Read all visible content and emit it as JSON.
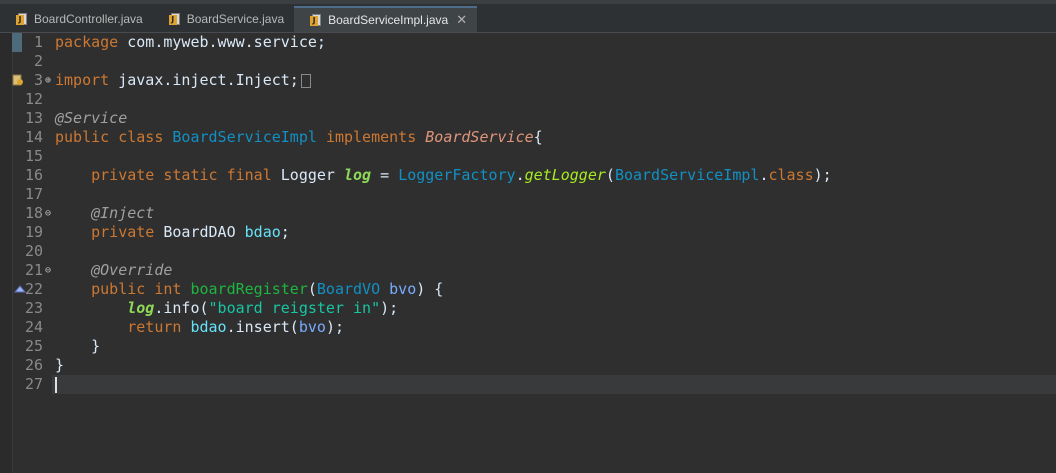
{
  "tabs": [
    {
      "label": "BoardController.java",
      "active": false
    },
    {
      "label": "BoardService.java",
      "active": false
    },
    {
      "label": "BoardServiceImpl.java",
      "active": true
    }
  ],
  "close_glyph": "✕",
  "lines": [
    {
      "num": "1",
      "fold": "",
      "tokens": [
        {
          "t": "package",
          "c": "kw"
        },
        {
          "t": " com.myweb.www.service;",
          "c": "plain"
        }
      ]
    },
    {
      "num": "2",
      "fold": "",
      "tokens": []
    },
    {
      "num": "3",
      "fold": "⊕",
      "tokens": [
        {
          "t": "import",
          "c": "kw"
        },
        {
          "t": " javax.inject.Inject;",
          "c": "plain"
        }
      ]
    },
    {
      "num": "12",
      "fold": "",
      "tokens": []
    },
    {
      "num": "13",
      "fold": "",
      "tokens": [
        {
          "t": "@Service",
          "c": "ann"
        }
      ]
    },
    {
      "num": "14",
      "fold": "",
      "tokens": [
        {
          "t": "public class ",
          "c": "kw"
        },
        {
          "t": "BoardServiceImpl",
          "c": "type"
        },
        {
          "t": " ",
          "c": "plain"
        },
        {
          "t": "implements",
          "c": "kw"
        },
        {
          "t": " ",
          "c": "plain"
        },
        {
          "t": "BoardService",
          "c": "iface"
        },
        {
          "t": "{",
          "c": "plain"
        }
      ]
    },
    {
      "num": "15",
      "fold": "",
      "tokens": []
    },
    {
      "num": "16",
      "fold": "",
      "tokens": [
        {
          "t": "    ",
          "c": "plain"
        },
        {
          "t": "private static final",
          "c": "kw"
        },
        {
          "t": " Logger ",
          "c": "plain"
        },
        {
          "t": "log",
          "c": "static-field"
        },
        {
          "t": " = ",
          "c": "plain"
        },
        {
          "t": "LoggerFactory",
          "c": "type"
        },
        {
          "t": ".",
          "c": "plain"
        },
        {
          "t": "getLogger",
          "c": "method-static"
        },
        {
          "t": "(",
          "c": "plain"
        },
        {
          "t": "BoardServiceImpl",
          "c": "type"
        },
        {
          "t": ".",
          "c": "plain"
        },
        {
          "t": "class",
          "c": "kw"
        },
        {
          "t": ");",
          "c": "plain"
        }
      ]
    },
    {
      "num": "17",
      "fold": "",
      "tokens": []
    },
    {
      "num": "18",
      "fold": "⊖",
      "tokens": [
        {
          "t": "    ",
          "c": "plain"
        },
        {
          "t": "@Inject",
          "c": "ann"
        }
      ]
    },
    {
      "num": "19",
      "fold": "",
      "tokens": [
        {
          "t": "    ",
          "c": "plain"
        },
        {
          "t": "private",
          "c": "kw"
        },
        {
          "t": " BoardDAO ",
          "c": "plain"
        },
        {
          "t": "bdao",
          "c": "field"
        },
        {
          "t": ";",
          "c": "plain"
        }
      ]
    },
    {
      "num": "20",
      "fold": "",
      "tokens": []
    },
    {
      "num": "21",
      "fold": "⊖",
      "tokens": [
        {
          "t": "    ",
          "c": "plain"
        },
        {
          "t": "@Override",
          "c": "ann"
        }
      ]
    },
    {
      "num": "22",
      "fold": "",
      "tokens": [
        {
          "t": "    ",
          "c": "plain"
        },
        {
          "t": "public int",
          "c": "kw"
        },
        {
          "t": " ",
          "c": "plain"
        },
        {
          "t": "boardRegister",
          "c": "method-decl"
        },
        {
          "t": "(",
          "c": "plain"
        },
        {
          "t": "BoardVO",
          "c": "type"
        },
        {
          "t": " ",
          "c": "plain"
        },
        {
          "t": "bvo",
          "c": "param"
        },
        {
          "t": ") {",
          "c": "plain"
        }
      ]
    },
    {
      "num": "23",
      "fold": "",
      "tokens": [
        {
          "t": "        ",
          "c": "plain"
        },
        {
          "t": "log",
          "c": "static-field"
        },
        {
          "t": ".info(",
          "c": "plain"
        },
        {
          "t": "\"board reigster in\"",
          "c": "str"
        },
        {
          "t": ");",
          "c": "plain"
        }
      ]
    },
    {
      "num": "24",
      "fold": "",
      "tokens": [
        {
          "t": "        ",
          "c": "plain"
        },
        {
          "t": "return",
          "c": "kw"
        },
        {
          "t": " ",
          "c": "plain"
        },
        {
          "t": "bdao",
          "c": "field"
        },
        {
          "t": ".insert(",
          "c": "plain"
        },
        {
          "t": "bvo",
          "c": "param"
        },
        {
          "t": ");",
          "c": "plain"
        }
      ]
    },
    {
      "num": "25",
      "fold": "",
      "tokens": [
        {
          "t": "    }",
          "c": "plain"
        }
      ]
    },
    {
      "num": "26",
      "fold": "",
      "tokens": [
        {
          "t": "}",
          "c": "plain"
        }
      ]
    },
    {
      "num": "27",
      "fold": "",
      "tokens": []
    }
  ],
  "icons": {
    "java_file": "java-file-icon",
    "override_marker": "override-triangle-icon",
    "import_warning": "import-warning-icon"
  }
}
